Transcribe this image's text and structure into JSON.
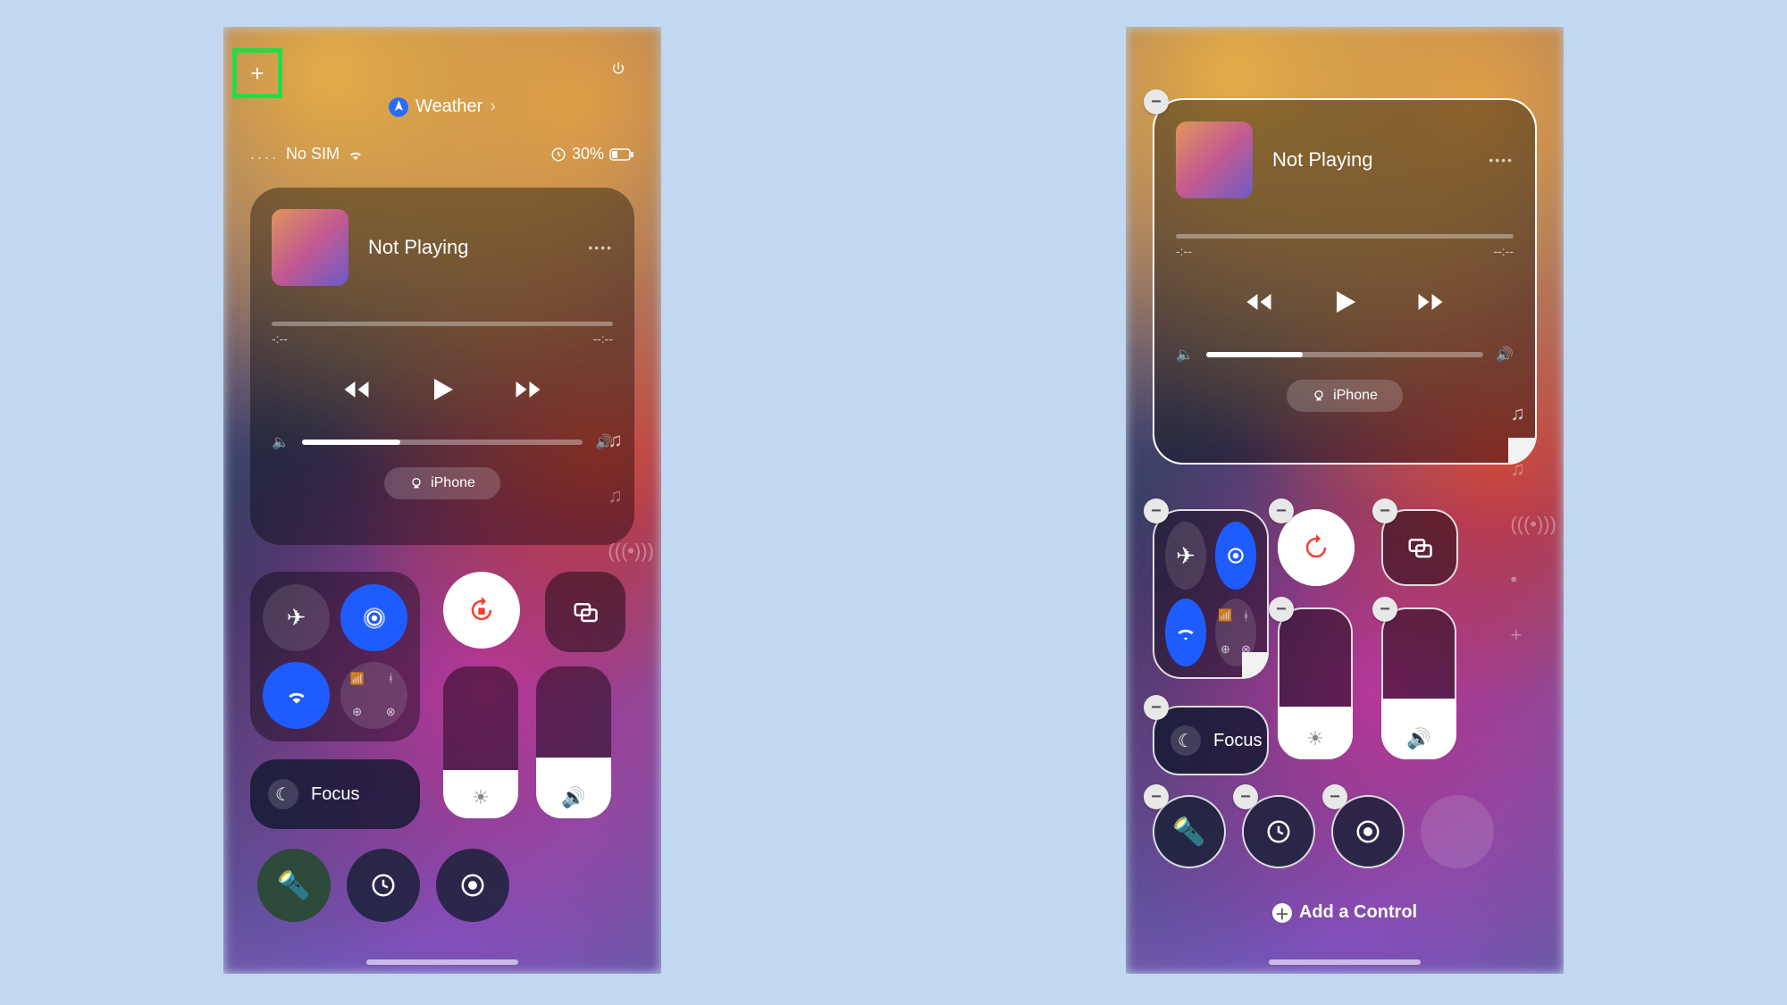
{
  "breadcrumb": {
    "label": "Weather"
  },
  "status": {
    "carrier": "No SIM",
    "battery_pct": "30%"
  },
  "music": {
    "title": "Not Playing",
    "time_left": "-:--",
    "time_right": "--:--",
    "airplay_target": "iPhone"
  },
  "focus": {
    "label": "Focus"
  },
  "add_control": {
    "label": "Add a Control"
  },
  "icons": {
    "plus": "+",
    "power": "⏻",
    "location": "➤",
    "chevron": "›",
    "wifi": "􀙇",
    "rewind": "◀◀",
    "play": "▶",
    "forward": "▶▶",
    "speaker_low": "🔈",
    "speaker_high": "🔊",
    "airplay": "◎",
    "airplane": "✈",
    "airdrop": "◎",
    "cellular": "📶",
    "bluetooth": "ᚼ",
    "lock_rotate": "🔒",
    "mirror": "⧉",
    "moon": "☾",
    "brightness": "☀",
    "volume": "🔊",
    "flashlight": "🔦",
    "timer": "◷",
    "record": "◉",
    "music_note": "♫",
    "antenna": "⊚",
    "dot": "•",
    "minus": "−"
  }
}
